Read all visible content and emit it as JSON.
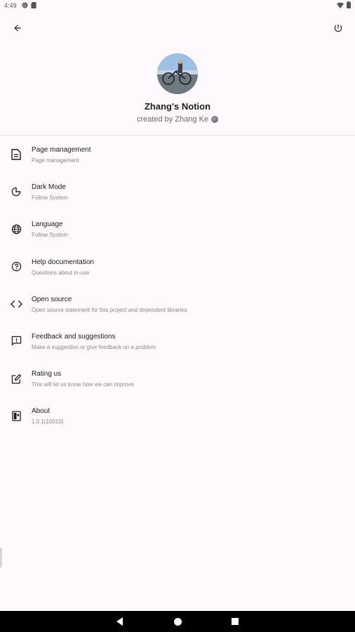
{
  "status_bar": {
    "time": "4:49"
  },
  "profile": {
    "name": "Zhang's Notion",
    "creator": "created by Zhang Ke"
  },
  "menu": [
    {
      "title": "Page management",
      "subtitle": "Page management",
      "icon": "document-icon"
    },
    {
      "title": "Dark Mode",
      "subtitle": "Follow System",
      "icon": "dark-mode-icon"
    },
    {
      "title": "Language",
      "subtitle": "Follow System",
      "icon": "globe-icon"
    },
    {
      "title": "Help documentation",
      "subtitle": "Questions about in-use",
      "icon": "help-icon"
    },
    {
      "title": "Open source",
      "subtitle": "Open source statement for this project and dependent libraries",
      "icon": "code-icon"
    },
    {
      "title": "Feedback and suggestions",
      "subtitle": "Make a suggestion or give feedback on a problem",
      "icon": "feedback-icon"
    },
    {
      "title": "Rating us",
      "subtitle": "This will let us know how we can improve",
      "icon": "rate-review-icon"
    },
    {
      "title": "About",
      "subtitle": "1.0.1(10010)",
      "icon": "about-icon"
    }
  ]
}
